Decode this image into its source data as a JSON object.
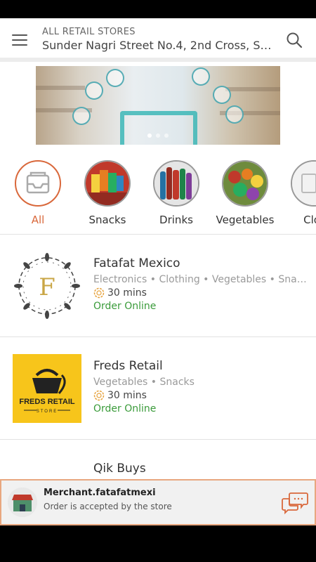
{
  "header": {
    "subtitle": "ALL RETAIL STORES",
    "address": "Sunder Nagri Street No.4, 2nd Cross, Su..."
  },
  "categories": [
    {
      "label": "All",
      "icon": "inbox-icon",
      "selected": true
    },
    {
      "label": "Snacks",
      "icon": "snacks-image"
    },
    {
      "label": "Drinks",
      "icon": "drinks-image"
    },
    {
      "label": "Vegetables",
      "icon": "vegetables-image"
    },
    {
      "label": "Clot",
      "icon": "clothing-image"
    }
  ],
  "stores": [
    {
      "name": "Fatafat Mexico",
      "tags": "Electronics • Clothing • Vegetables • Snack...",
      "time": "30 mins",
      "order": "Order Online",
      "logo_letter": "F"
    },
    {
      "name": "Freds Retail",
      "tags": "Vegetables • Snacks",
      "time": "30 mins",
      "order": "Order Online",
      "logo_line1": "FREDS RETAIL",
      "logo_line2": "STORE"
    },
    {
      "name": "Qik Buys",
      "tags": "",
      "time": "",
      "order": ""
    }
  ],
  "notification": {
    "title": "Merchant.fatafatmexi",
    "message": "Order is accepted by the store"
  },
  "colors": {
    "accent": "#d9683b",
    "order_green": "#3a9b3a",
    "freds_yellow": "#f7c51b",
    "logo_gold": "#c9a646"
  }
}
